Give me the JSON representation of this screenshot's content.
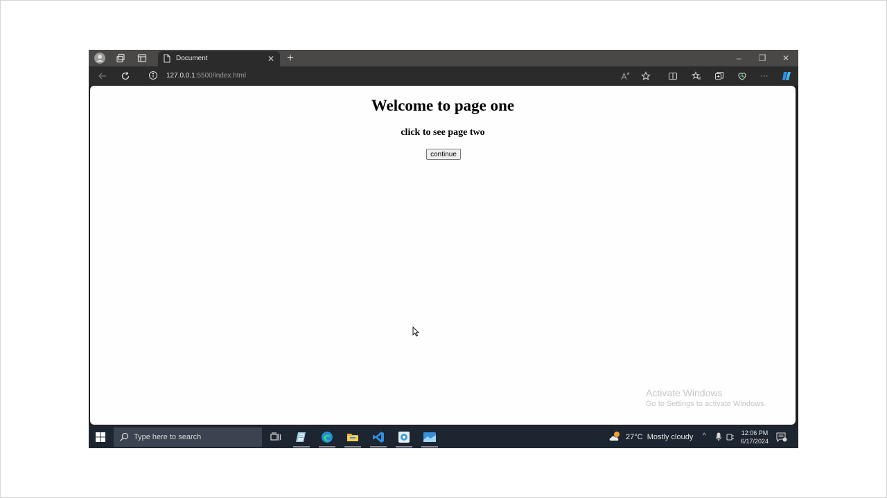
{
  "browser": {
    "tab_title": "Document",
    "tab_close": "✕",
    "new_tab": "+",
    "url_host": "127.0.0.1",
    "url_rest": ":5500/index.html",
    "window_controls": {
      "minimize": "–",
      "restore": "❐",
      "close": "✕"
    },
    "toolbar_more": "···"
  },
  "page": {
    "heading": "Welcome to page one",
    "subheading": "click to see page two",
    "button_label": "continue"
  },
  "watermark": {
    "title": "Activate Windows",
    "subtitle": "Go to Settings to activate Windows."
  },
  "taskbar": {
    "search_placeholder": "Type here to search",
    "weather_temp": "27°C",
    "weather_text": "Mostly cloudy",
    "time": "12:06 PM",
    "date": "6/17/2024",
    "tray_chevron": "^"
  },
  "colors": {
    "vscode_blue": "#2f8fe0",
    "edge_blue": "#1e90d8",
    "folder_yellow": "#e8b634"
  }
}
